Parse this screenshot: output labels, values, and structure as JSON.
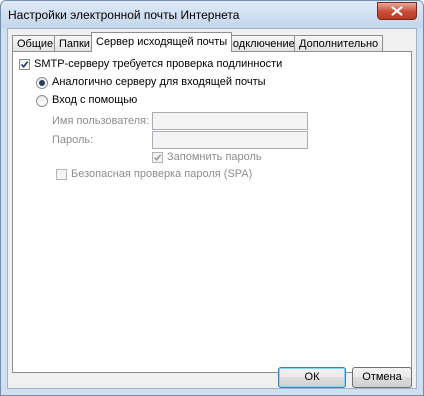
{
  "window": {
    "title": "Настройки электронной почты Интернета"
  },
  "tabs": [
    {
      "label": "Общие"
    },
    {
      "label": "Папки"
    },
    {
      "label": "Сервер исходящей почты"
    },
    {
      "label": "Подключение"
    },
    {
      "label": "Дополнительно"
    }
  ],
  "active_tab": "Сервер исходящей почты",
  "smtp": {
    "auth_required_label": "SMTP-серверу требуется проверка подлинности",
    "auth_required_checked": true,
    "same_as_incoming_label": "Аналогично серверу для входящей почты",
    "same_as_incoming_selected": true,
    "login_with_label": "Вход с помощью",
    "login_with_selected": false,
    "username_label": "Имя пользователя:",
    "username_value": "",
    "password_label": "Пароль:",
    "password_value": "",
    "remember_password_label": "Запомнить пароль",
    "remember_password_checked": true,
    "spa_label": "Безопасная проверка пароля (SPA)",
    "spa_checked": false
  },
  "buttons": {
    "ok": "ОК",
    "cancel": "Отмена"
  },
  "colors": {
    "accent": "#3c7fb1",
    "close_button": "#c74d34",
    "disabled_text": "#8d8d8d"
  }
}
